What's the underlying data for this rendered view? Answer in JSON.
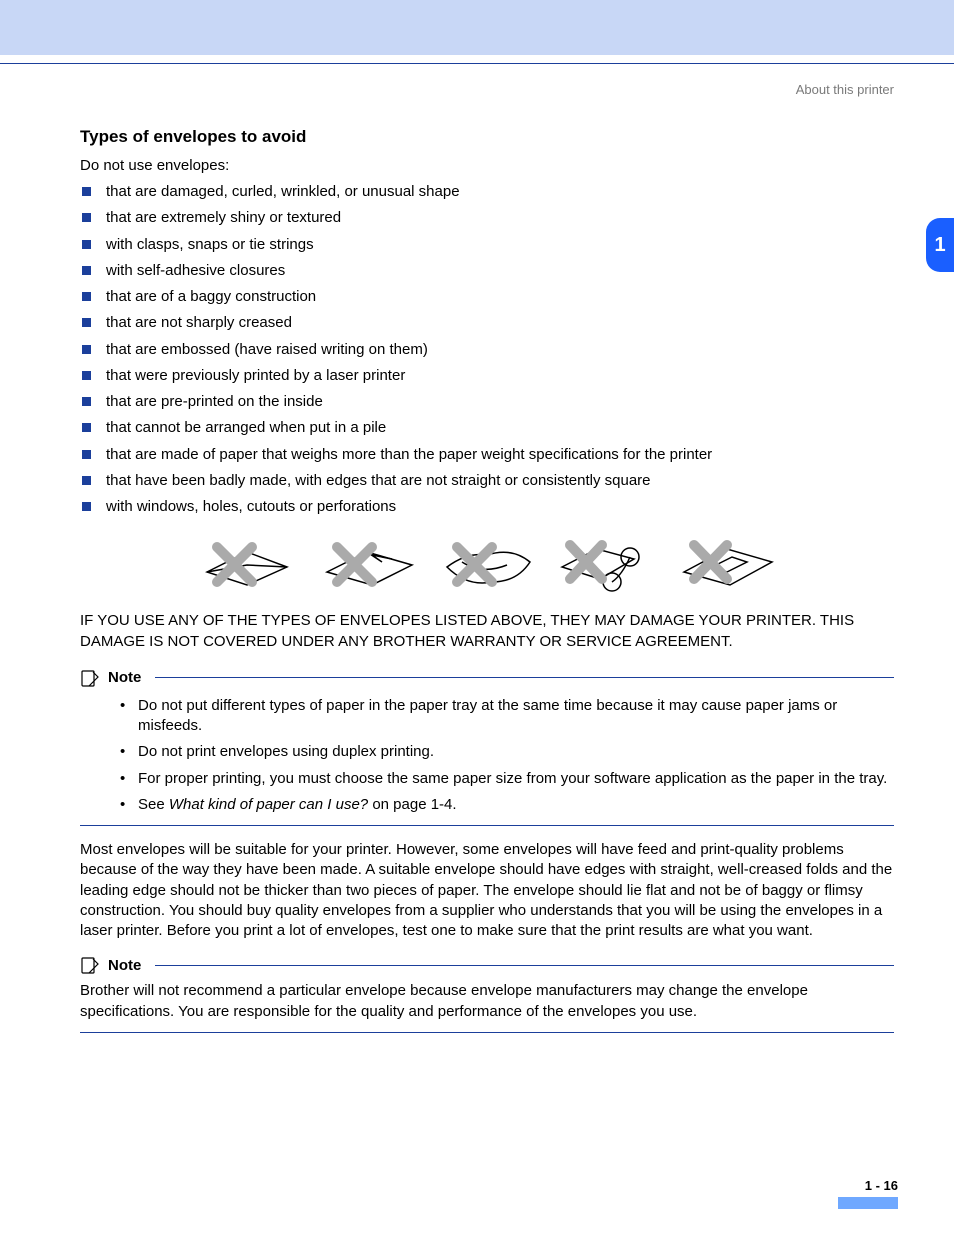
{
  "header": {
    "section": "About this printer"
  },
  "chapter_tab": "1",
  "title": "Types of envelopes to avoid",
  "intro": "Do not use envelopes:",
  "avoid_list": [
    "that are damaged, curled, wrinkled, or unusual shape",
    "that are extremely shiny or textured",
    "with clasps, snaps or tie strings",
    "with self-adhesive closures",
    "that are of a baggy construction",
    "that are not sharply creased",
    "that are embossed (have raised writing on them)",
    "that were previously printed by a laser printer",
    "that are pre-printed on the inside",
    "that cannot be arranged when put in a pile",
    "that are made of paper that weighs more than the paper weight specifications for the printer",
    "that have been badly made, with edges that are not straight or consistently square",
    "with windows, holes, cutouts or perforations"
  ],
  "warning": "IF YOU USE ANY OF THE TYPES OF ENVELOPES LISTED ABOVE, THEY MAY DAMAGE YOUR PRINTER. THIS DAMAGE IS NOT COVERED UNDER ANY BROTHER WARRANTY OR SERVICE AGREEMENT.",
  "note1": {
    "label": "Note",
    "items": [
      {
        "text": "Do not put different types of paper in the paper tray at the same time because it may cause paper jams or misfeeds."
      },
      {
        "text": "Do not print envelopes using duplex printing."
      },
      {
        "text": "For proper printing, you must choose the same paper size from your software application as the paper in the tray."
      },
      {
        "prefix": "See ",
        "italic": "What kind of paper can I use?",
        "suffix": " on page 1-4."
      }
    ]
  },
  "body_para": "Most envelopes will be suitable for your printer. However, some envelopes will have feed and print-quality problems because of the way they have been made. A suitable envelope should have edges with straight, well-creased folds and the leading edge should not be thicker than two pieces of paper. The envelope should lie flat and not be of baggy or flimsy construction. You should buy quality envelopes from a supplier who understands that you will be using the envelopes in a laser printer. Before you print a lot of envelopes, test one to make sure that the print results are what you want.",
  "note2": {
    "label": "Note",
    "text": "Brother will not recommend a particular envelope because envelope manufacturers may change the envelope specifications. You are responsible for the quality and performance of the envelopes you use."
  },
  "footer": {
    "page": "1 - 16"
  }
}
